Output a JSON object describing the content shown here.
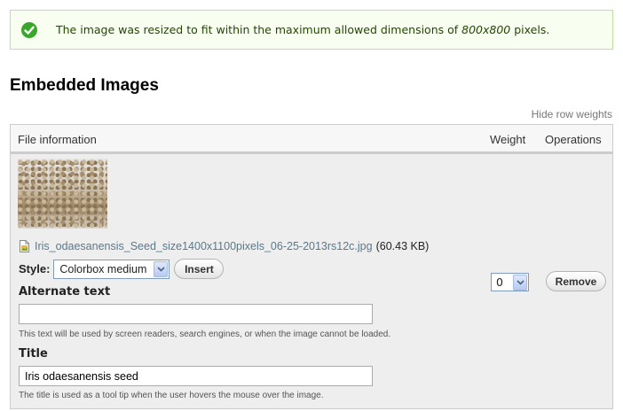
{
  "status": {
    "message_pre": "The image was resized to fit within the maximum allowed dimensions of ",
    "message_em": "800x800",
    "message_post": " pixels."
  },
  "section": {
    "title": "Embedded Images",
    "hide_weights_link": "Hide row weights"
  },
  "table": {
    "headers": {
      "file_information": "File information",
      "weight": "Weight",
      "operations": "Operations"
    },
    "rows": [
      {
        "file_name": "Iris_odaesanensis_Seed_size1400x1100pixels_06-25-2013rs12c.jpg",
        "file_size": "(60.43 KB)",
        "style_label": "Style:",
        "style_value": "Colorbox medium",
        "insert_label": "Insert",
        "alt_label": "Alternate text",
        "alt_value": "",
        "alt_description": "This text will be used by screen readers, search engines, or when the image cannot be loaded.",
        "title_label": "Title",
        "title_value": "Iris odaesanensis seed",
        "title_description": "The title is used as a tool tip when the user hovers the mouse over the image.",
        "weight_value": "0",
        "remove_label": "Remove"
      }
    ]
  },
  "icons": {
    "status": "checkmark-circle-icon",
    "file": "image-file-icon",
    "dropdown": "chevron-down-icon"
  },
  "colors": {
    "status_bg": "#f8fff0",
    "status_border": "#bbe0a0",
    "status_icon": "#3aa62c",
    "link": "#5a7a8a"
  }
}
